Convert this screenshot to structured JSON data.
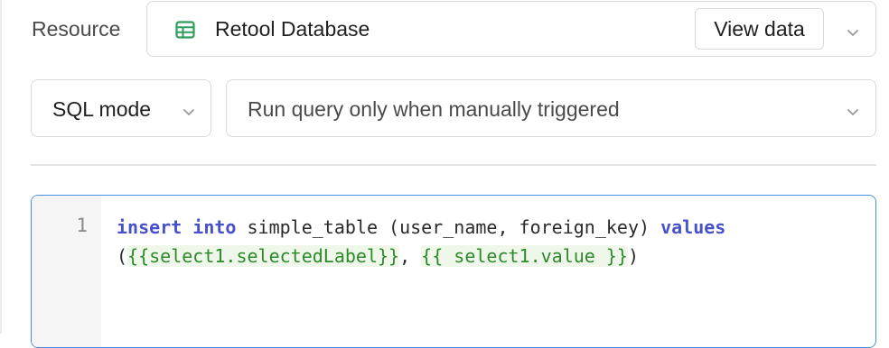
{
  "resource": {
    "label": "Resource",
    "value": "Retool Database",
    "icon": "table-grid-icon",
    "view_data_label": "View data"
  },
  "mode": {
    "value": "SQL mode"
  },
  "trigger": {
    "value": "Run query only when manually triggered"
  },
  "editor": {
    "line_number": "1",
    "tokens": {
      "kw_insert": "insert",
      "kw_into": "into",
      "plain1": " simple_table (user_name, foreign_key) ",
      "kw_values": "values",
      "open_paren": "(",
      "tmpl1": "{{select1.selectedLabel}}",
      "comma": ", ",
      "tmpl2": "{{ select1.value }}",
      "close_paren": ")"
    }
  },
  "colors": {
    "keyword": "#4751c9",
    "template": "#2d8a2a",
    "focus_border": "#4a90e2",
    "db_icon": "#2e9e5b"
  }
}
